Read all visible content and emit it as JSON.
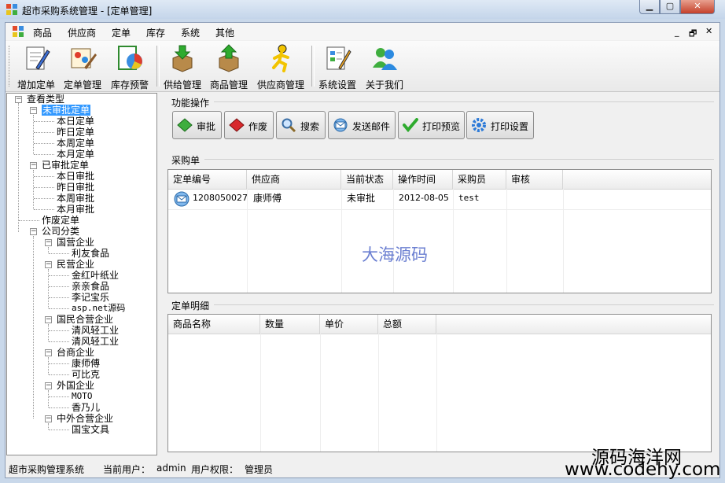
{
  "window": {
    "title": "超市采购系统管理 - [定单管理]"
  },
  "menu": {
    "items": [
      "商品",
      "供应商",
      "定单",
      "库存",
      "系统",
      "其他"
    ]
  },
  "toolbar": {
    "buttons": [
      "增加定单",
      "定单管理",
      "库存预警",
      "供给管理",
      "商品管理",
      "供应商管理",
      "系统设置",
      "关于我们"
    ]
  },
  "tree": {
    "root": "查看类型",
    "unapproved": {
      "label": "未审批定单",
      "children": [
        "本日定单",
        "昨日定单",
        "本周定单",
        "本月定单"
      ]
    },
    "approved": {
      "label": "已审批定单",
      "children": [
        "本日审批",
        "昨日审批",
        "本周审批",
        "本月审批"
      ]
    },
    "voided": "作废定单",
    "company": {
      "label": "公司分类",
      "groups": [
        {
          "label": "国营企业",
          "children": [
            "利友食品"
          ]
        },
        {
          "label": "民营企业",
          "children": [
            "金红叶纸业",
            "亲亲食品",
            "李记宝乐",
            "asp.net源码"
          ]
        },
        {
          "label": "国民合营企业",
          "children": [
            "清风轻工业",
            "清风轻工业"
          ]
        },
        {
          "label": "台商企业",
          "children": [
            "康师傅",
            "可比克"
          ]
        },
        {
          "label": "外国企业",
          "children": [
            "MOTO",
            "香乃儿"
          ]
        },
        {
          "label": "中外合营企业",
          "children": [
            "国宝文具"
          ]
        }
      ]
    }
  },
  "functions": {
    "title": "功能操作",
    "buttons": [
      "审批",
      "作废",
      "搜索",
      "发送邮件",
      "打印预览",
      "打印设置"
    ]
  },
  "purchase": {
    "title": "采购单",
    "columns": [
      "定单编号",
      "供应商",
      "当前状态",
      "操作时间",
      "采购员",
      "审核"
    ],
    "rows": [
      {
        "id": "1208050027",
        "supplier": "康师傅",
        "status": "未审批",
        "time": "2012-08-05",
        "buyer": "test",
        "audit": ""
      }
    ]
  },
  "detail": {
    "title": "定单明细",
    "columns": [
      "商品名称",
      "数量",
      "单价",
      "总额"
    ]
  },
  "status": {
    "app": "超市采购管理系统",
    "user_label": "当前用户：",
    "user": "admin",
    "perm_label": "用户权限：",
    "perm": "管理员"
  },
  "watermarks": {
    "center": "大海源码",
    "corner_cn": "源码海洋网",
    "corner_url": "www.codehy.com"
  },
  "colors": {
    "selection": "#3399ff",
    "watermark_center": "#6b7fd1"
  }
}
